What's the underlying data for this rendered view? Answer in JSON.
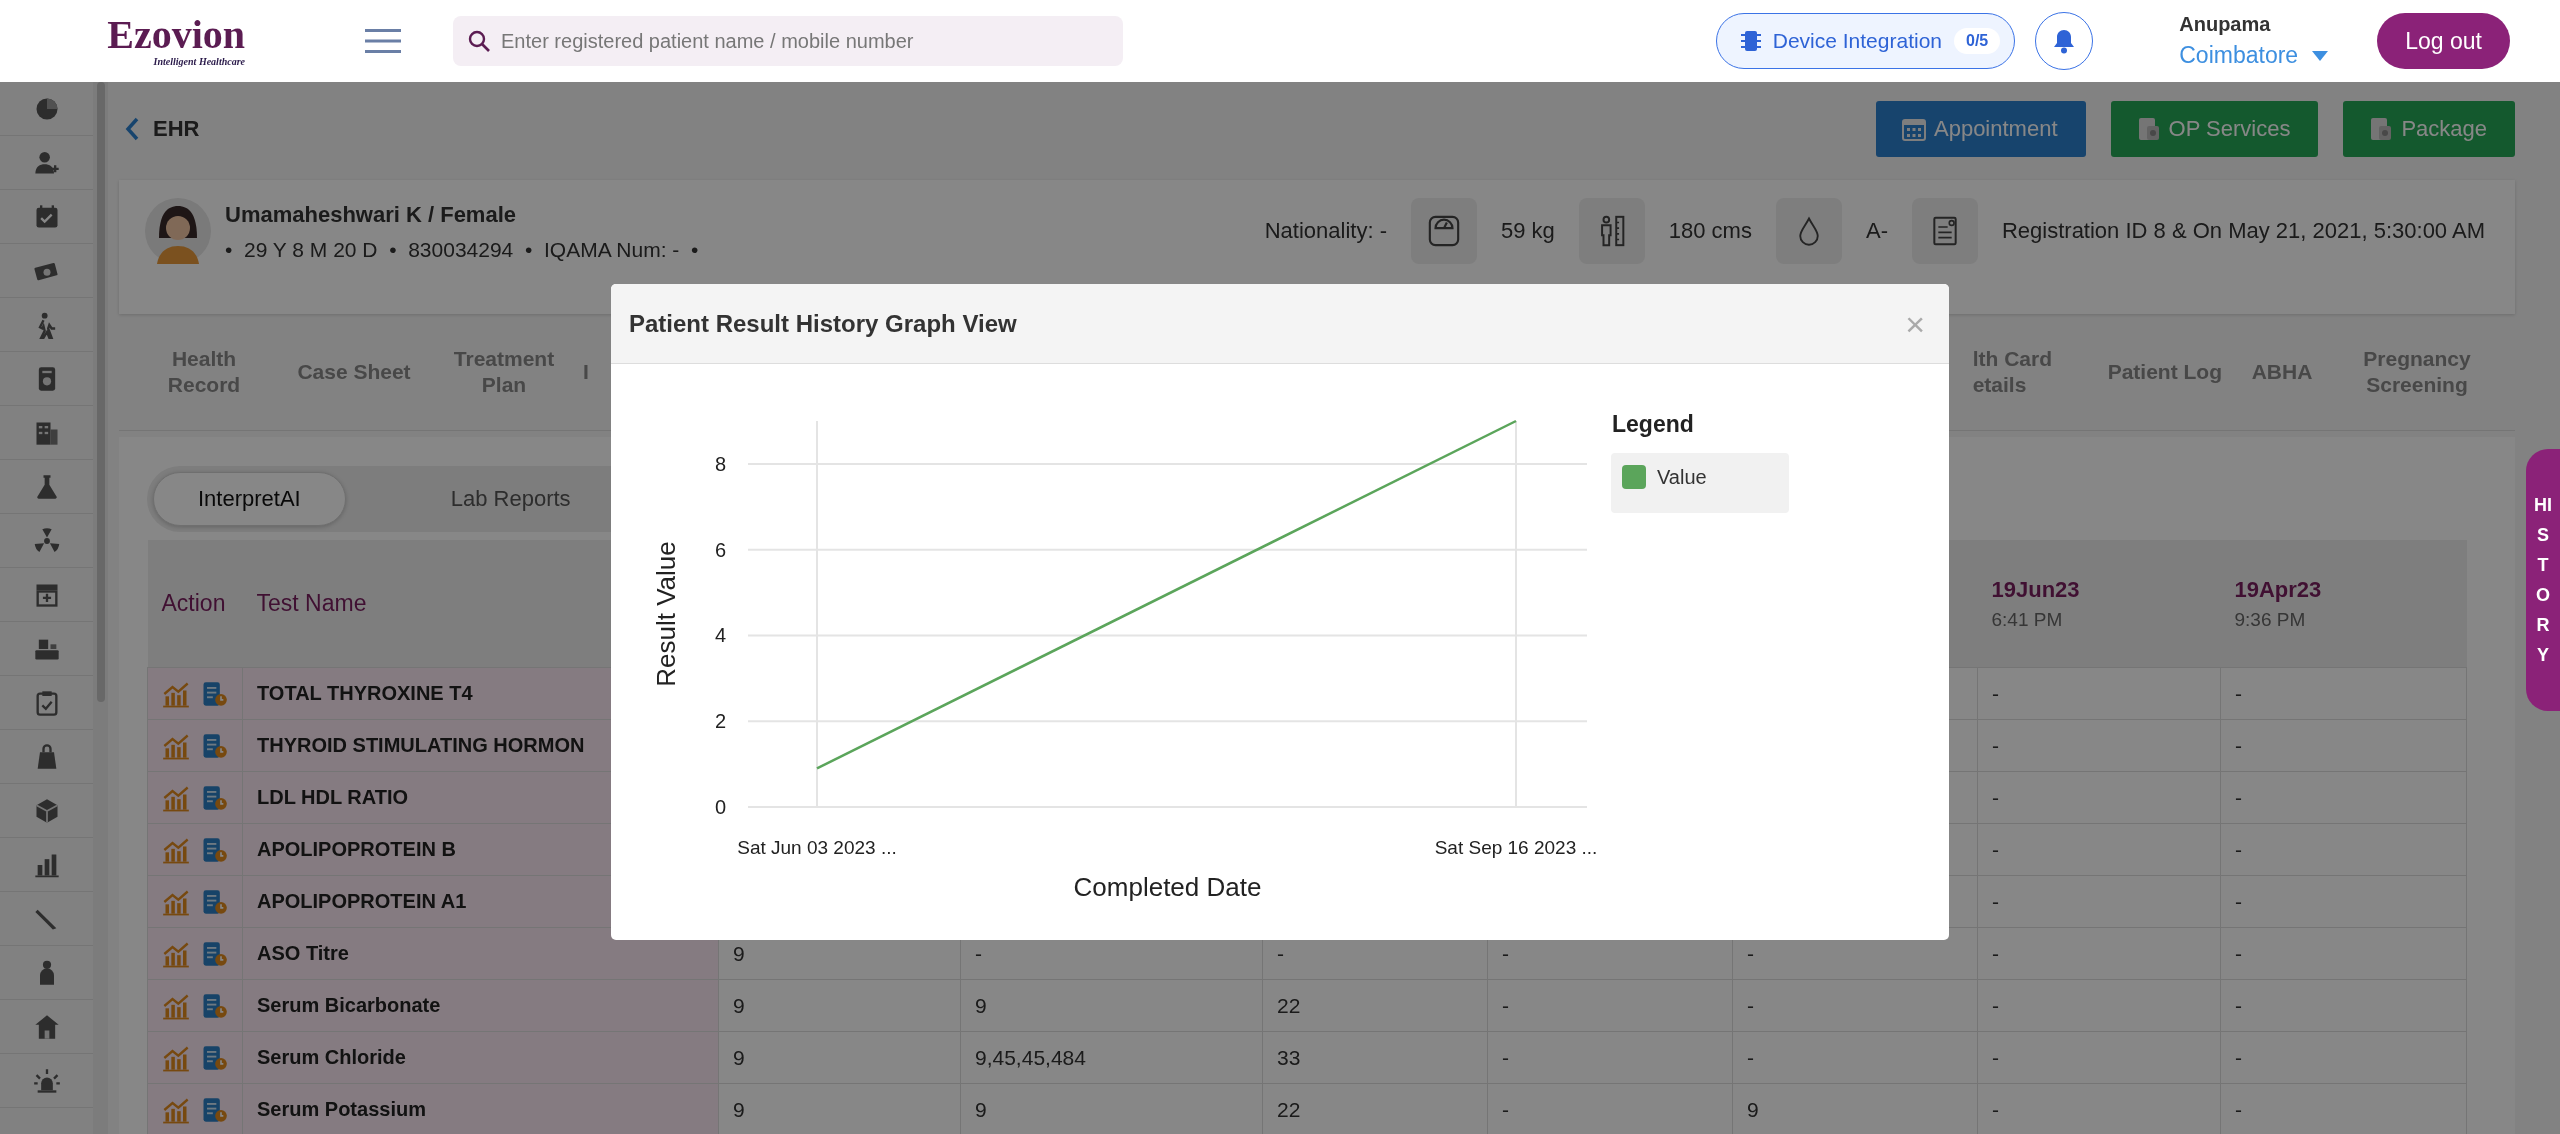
{
  "header": {
    "logo": "Ezovion",
    "logo_tagline": "Intelligent Healthcare",
    "search": {
      "placeholder": "Enter registered patient name / mobile number"
    },
    "device_integration": {
      "label": "Device Integration",
      "count": "0/5"
    },
    "user": {
      "name": "Anupama",
      "location": "Coimbatore"
    },
    "logout": "Log out"
  },
  "page": {
    "title": "EHR",
    "actions": [
      {
        "label": "Appointment",
        "kind": "primary"
      },
      {
        "label": "OP Services",
        "kind": "success"
      },
      {
        "label": "Package",
        "kind": "success"
      }
    ]
  },
  "patient": {
    "name": "Umamaheshwari K / Female",
    "details": "•  29 Y 8 M 20 D  •  830034294  •  IQAMA Num: -  •",
    "nationality": "Nationality: -",
    "weight": "59 kg",
    "height": "180 cms",
    "blood_group": "A-",
    "registration": "Registration ID 8 & On May 21, 2021, 5:30:00 AM"
  },
  "record_tabs": {
    "left": [
      {
        "label": "Health Record",
        "selected": false
      },
      {
        "label": "Case Sheet",
        "selected": false
      },
      {
        "label": "Treatment Plan",
        "selected": false
      },
      {
        "label": "I",
        "selected": false
      }
    ],
    "right": [
      {
        "label": "lth Card etails",
        "selected": false
      },
      {
        "label": "Patient Log",
        "selected": false
      },
      {
        "label": "ABHA",
        "selected": false
      },
      {
        "label": "Pregnancy Screening",
        "selected": false
      }
    ]
  },
  "lab_tabs": [
    {
      "label": "InterpretAI",
      "selected": true
    },
    {
      "label": "Lab Reports",
      "selected": false
    }
  ],
  "table": {
    "columns": {
      "column_1": {
        "label": "Action"
      },
      "column_2": {
        "label": "Test Name"
      },
      "column_8": {
        "label": "19Jun23",
        "time": "6:41 PM"
      },
      "column_9": {
        "label": "19Apr23",
        "time": "9:36 PM"
      }
    },
    "rows": [
      {
        "test": "TOTAL THYROXINE T4",
        "column_8": "-",
        "column_9": "-"
      },
      {
        "test": "THYROID STIMULATING HORMON",
        "column_8": "-",
        "column_9": "-"
      },
      {
        "test": "LDL HDL RATIO",
        "column_8": "-",
        "column_9": "-"
      },
      {
        "test": "APOLIPOPROTEIN B",
        "column_8": "-",
        "column_9": "-"
      },
      {
        "test": "APOLIPOPROTEIN A1",
        "column_8": "-",
        "column_9": "-"
      },
      {
        "test": "ASO Titre",
        "column_3": "9",
        "column_4": "-",
        "column_5": "-",
        "column_6": "-",
        "column_7": "-",
        "column_8": "-",
        "column_9": "-"
      },
      {
        "test": "Serum Bicarbonate",
        "column_3": "9",
        "column_4": "9",
        "column_5": "22",
        "column_6": "-",
        "column_7": "-",
        "column_8": "-",
        "column_9": "-"
      },
      {
        "test": "Serum Chloride",
        "column_3": "9",
        "column_4": "9,45,45,484",
        "column_5": "33",
        "column_6": "-",
        "column_7": "-",
        "column_8": "-",
        "column_9": "-"
      },
      {
        "test": "Serum Potassium",
        "column_3": "9",
        "column_4": "9",
        "column_5": "22",
        "column_6": "-",
        "column_7": "9",
        "column_8": "-",
        "column_9": "-"
      }
    ]
  },
  "modal": {
    "title": "Patient Result History Graph View",
    "close": "×",
    "legend_title": "Legend",
    "chart_data": {
      "type": "line",
      "xlabel": "Completed Date",
      "ylabel": "Result Value",
      "categories": [
        "Sat Jun 03 2023 ...",
        "Sat Sep 16 2023 ..."
      ],
      "series": [
        {
          "name": "Value",
          "color": "#5ba55b",
          "values": [
            0.9,
            9
          ]
        }
      ],
      "ylim": [
        0,
        9
      ],
      "yticks": [
        0,
        2,
        4,
        6,
        8
      ],
      "grid": true
    }
  },
  "history_tab": "HISTORY"
}
